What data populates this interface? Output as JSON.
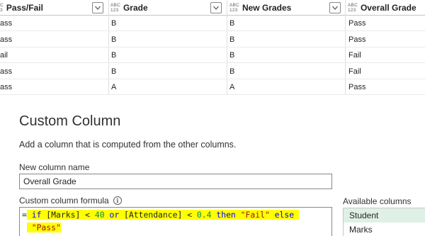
{
  "grid": {
    "columns": [
      {
        "type_top": "C",
        "type_bottom": "3",
        "label": "Pass/Fail"
      },
      {
        "type_top": "ABC",
        "type_bottom": "123",
        "label": "Grade"
      },
      {
        "type_top": "ABC",
        "type_bottom": "123",
        "label": "New Grades"
      },
      {
        "type_top": "ABC",
        "type_bottom": "123",
        "label": "Overall Grade"
      }
    ],
    "rows": [
      [
        "ass",
        "B",
        "B",
        "Pass"
      ],
      [
        "ass",
        "B",
        "B",
        "Pass"
      ],
      [
        "ail",
        "B",
        "B",
        "Fail"
      ],
      [
        "ass",
        "B",
        "B",
        "Fail"
      ],
      [
        "ass",
        "A",
        "A",
        "Pass"
      ]
    ]
  },
  "dialog": {
    "title": "Custom Column",
    "description": "Add a column that is computed from the other columns.",
    "column_name_label": "New column name",
    "column_name_value": "Overall Grade",
    "formula_label": "Custom column formula",
    "info_icon": "info-icon",
    "formula": {
      "eq": "=",
      "kw_if": "if",
      "field1": "[Marks]",
      "op1": "<",
      "num1": "40",
      "kw_or": "or",
      "field2": "[Attendance]",
      "op2": "<",
      "num2": "0.4",
      "kw_then": "then",
      "str_fail": "\"Fail\"",
      "kw_else": "else",
      "str_pass": "\"Pass\""
    },
    "available_label": "Available columns",
    "available_columns": [
      "Student",
      "Marks"
    ]
  },
  "colors": {
    "highlight": "#ffff00",
    "selected_item": "#dff0e6"
  }
}
